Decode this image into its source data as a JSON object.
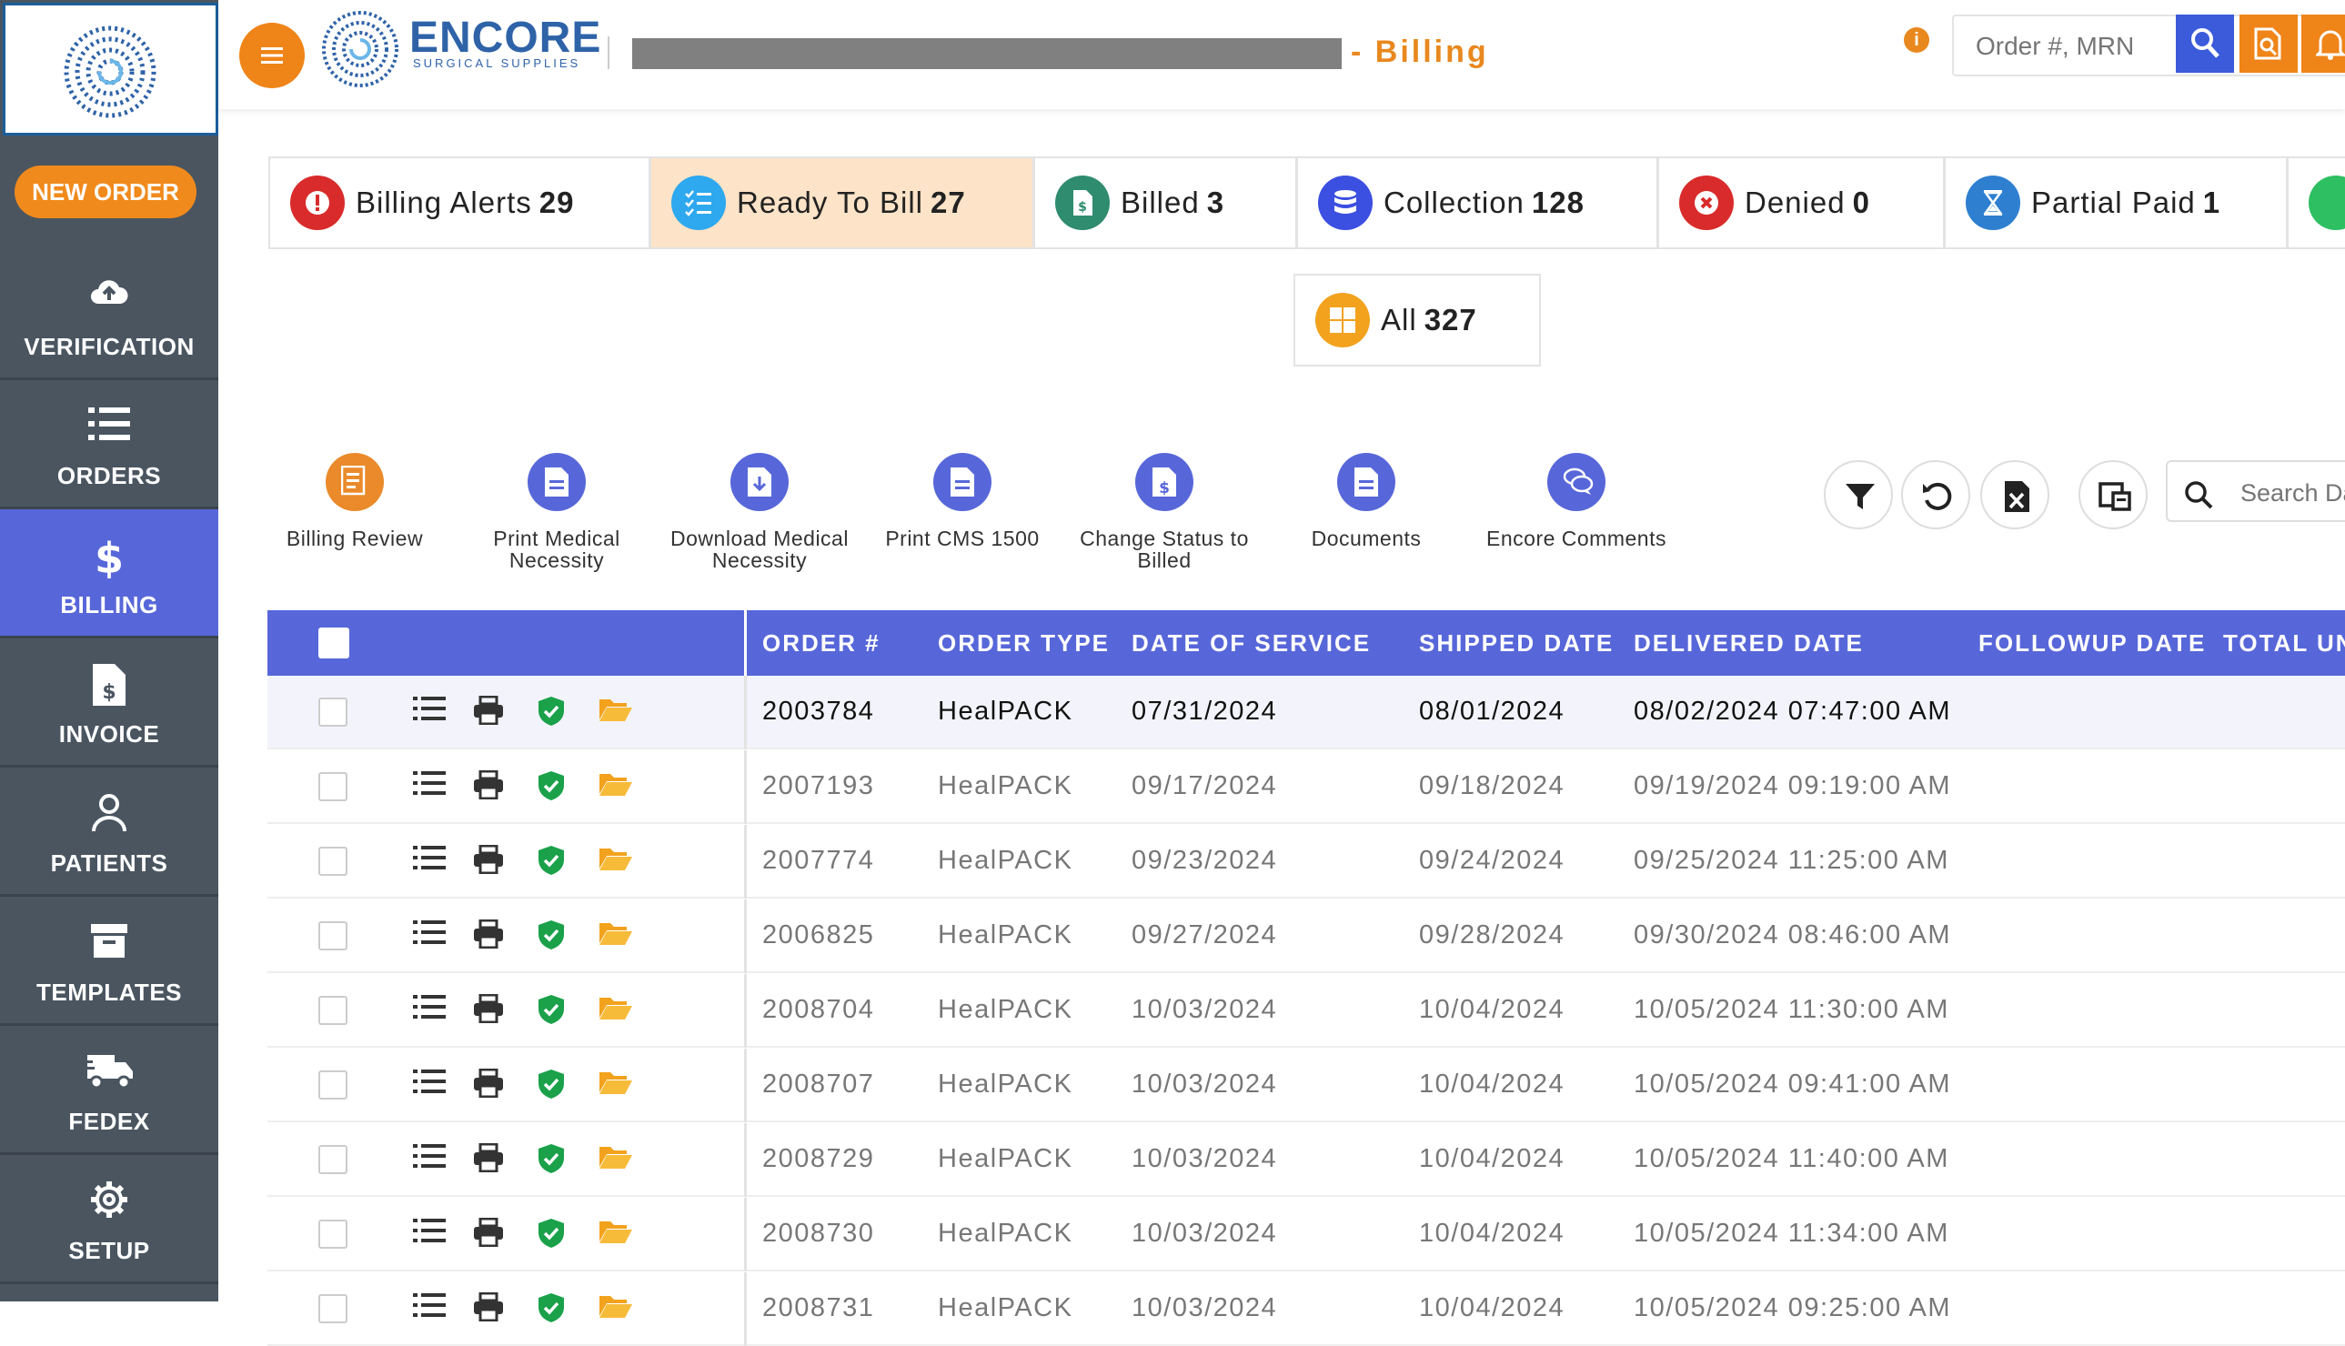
{
  "sidebar": {
    "new_order": "NEW ORDER",
    "items": [
      {
        "label": "VERIFICATION",
        "icon": "cloud-upload-icon"
      },
      {
        "label": "ORDERS",
        "icon": "list-icon"
      },
      {
        "label": "BILLING",
        "icon": "dollar-icon",
        "active": true
      },
      {
        "label": "INVOICE",
        "icon": "invoice-icon"
      },
      {
        "label": "PATIENTS",
        "icon": "user-icon"
      },
      {
        "label": "TEMPLATES",
        "icon": "archive-icon"
      },
      {
        "label": "FEDEX",
        "icon": "truck-icon"
      },
      {
        "label": "SETUP",
        "icon": "gear-icon"
      }
    ]
  },
  "header": {
    "brand_name": "ENCORE",
    "brand_sub": "SURGICAL SUPPLIES",
    "page_title": "- Billing",
    "search_placeholder": "Order #, MRN"
  },
  "status_tabs": [
    {
      "label": "Billing Alerts",
      "count": "29",
      "color": "#d92b2b",
      "icon": "alert-icon"
    },
    {
      "label": "Ready To Bill",
      "count": "27",
      "color": "#2ea8ef",
      "icon": "checklist-icon",
      "active": true
    },
    {
      "label": "Billed",
      "count": "3",
      "color": "#2f8c6e",
      "icon": "bill-icon"
    },
    {
      "label": "Collection",
      "count": "128",
      "color": "#3b4fe0",
      "icon": "database-icon"
    },
    {
      "label": "Denied",
      "count": "0",
      "color": "#d92b2b",
      "icon": "x-circle-icon"
    },
    {
      "label": "Partial Paid",
      "count": "1",
      "color": "#2f7fd0",
      "icon": "hourglass-icon"
    },
    {
      "label": "All",
      "count": "327",
      "color": "#f2a21d",
      "icon": "grid-icon"
    }
  ],
  "toolbar": [
    {
      "label": "Billing Review",
      "icon": "billing-review-icon",
      "color": "#ea8a2a"
    },
    {
      "label": "Print Medical Necessity",
      "icon": "document-icon",
      "color": "#5767d9"
    },
    {
      "label": "Download Medical Necessity",
      "icon": "download-doc-icon",
      "color": "#5767d9"
    },
    {
      "label": "Print CMS 1500",
      "icon": "document-icon",
      "color": "#5767d9"
    },
    {
      "label": "Change Status to Billed",
      "icon": "dollar-doc-icon",
      "color": "#5767d9"
    },
    {
      "label": "Documents",
      "icon": "document-icon",
      "color": "#5767d9"
    },
    {
      "label": "Encore Comments",
      "icon": "comments-icon",
      "color": "#5767d9"
    }
  ],
  "table_search_placeholder": "Search Data",
  "table": {
    "columns": [
      "ORDER #",
      "ORDER TYPE",
      "DATE OF SERVICE",
      "SHIPPED DATE",
      "DELIVERED DATE",
      "FOLLOWUP DATE",
      "TOTAL UNITS"
    ],
    "rows": [
      {
        "order": "2003784",
        "type": "HealPACK",
        "dos": "07/31/2024",
        "shipped": "08/01/2024",
        "delivered": "08/02/2024 07:47:00 AM"
      },
      {
        "order": "2007193",
        "type": "HealPACK",
        "dos": "09/17/2024",
        "shipped": "09/18/2024",
        "delivered": "09/19/2024 09:19:00 AM"
      },
      {
        "order": "2007774",
        "type": "HealPACK",
        "dos": "09/23/2024",
        "shipped": "09/24/2024",
        "delivered": "09/25/2024 11:25:00 AM"
      },
      {
        "order": "2006825",
        "type": "HealPACK",
        "dos": "09/27/2024",
        "shipped": "09/28/2024",
        "delivered": "09/30/2024 08:46:00 AM"
      },
      {
        "order": "2008704",
        "type": "HealPACK",
        "dos": "10/03/2024",
        "shipped": "10/04/2024",
        "delivered": "10/05/2024 11:30:00 AM"
      },
      {
        "order": "2008707",
        "type": "HealPACK",
        "dos": "10/03/2024",
        "shipped": "10/04/2024",
        "delivered": "10/05/2024 09:41:00 AM"
      },
      {
        "order": "2008729",
        "type": "HealPACK",
        "dos": "10/03/2024",
        "shipped": "10/04/2024",
        "delivered": "10/05/2024 11:40:00 AM"
      },
      {
        "order": "2008730",
        "type": "HealPACK",
        "dos": "10/03/2024",
        "shipped": "10/04/2024",
        "delivered": "10/05/2024 11:34:00 AM"
      },
      {
        "order": "2008731",
        "type": "HealPACK",
        "dos": "10/03/2024",
        "shipped": "10/04/2024",
        "delivered": "10/05/2024 09:25:00 AM"
      }
    ]
  },
  "colors": {
    "accent": "#5767d9",
    "orange": "#ef8418",
    "sidebar": "#4a5560",
    "green": "#1aa14a"
  }
}
